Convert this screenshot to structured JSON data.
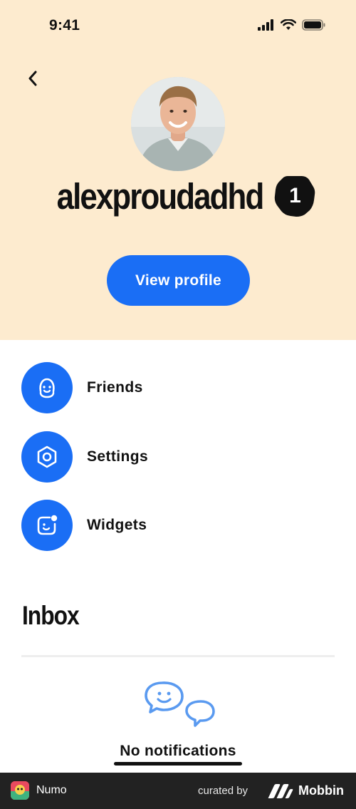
{
  "status_bar": {
    "time": "9:41"
  },
  "profile": {
    "username": "alexproudadhd",
    "level": "1",
    "view_profile_label": "View profile"
  },
  "menu": [
    {
      "label": "Friends",
      "icon": "smile-face-icon"
    },
    {
      "label": "Settings",
      "icon": "gear-hexagon-icon"
    },
    {
      "label": "Widgets",
      "icon": "widget-face-icon"
    }
  ],
  "inbox": {
    "title": "Inbox",
    "empty_title": "No notifications"
  },
  "footer": {
    "app_name": "Numo",
    "curated_by": "curated by",
    "brand": "Mobbin"
  },
  "colors": {
    "header_bg": "#fdebcf",
    "accent": "#1a6ef5",
    "illustration": "#5a9af0",
    "footer_bg": "#222222"
  }
}
